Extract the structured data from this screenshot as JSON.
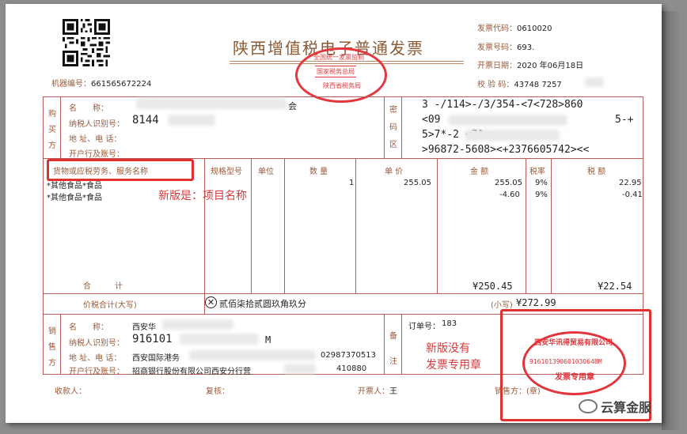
{
  "header": {
    "title": "陕西增值税电子普通发票",
    "machine_no_label": "机器编号：",
    "machine_no": "661565672224",
    "invoice_code_label": "发票代码：",
    "invoice_code": "0610020",
    "invoice_no_label": "发票号码：",
    "invoice_no": "693.",
    "issue_date_label": "开票日期：",
    "issue_date": "2020 年06月18日",
    "check_code_label": "校 验 码：",
    "check_code": "43748 7257"
  },
  "buyer": {
    "section_label": "购买方",
    "name_label": "名　　称：",
    "name_value": "会",
    "taxid_label": "纳税人识别号：",
    "taxid_value": "8144",
    "address_label": "地 址、电 话：",
    "bank_label": "开户行及账号："
  },
  "cipher": {
    "section_label": "密码区",
    "lines": [
      "3  -/114>-/3/354-<7<728>860",
      "<09",
      "5>7*-2                          <71<",
      ">96872-5608><+2376605742><<"
    ],
    "line2_tail": "5-+"
  },
  "items": {
    "headers": [
      "货物或应税劳务、服务名称",
      "规格型号",
      "单位",
      "数 量",
      "单 价",
      "金 额",
      "税率",
      "税 额"
    ],
    "rows": [
      {
        "name": "*其他食品*食品",
        "qty": "1",
        "price": "255.05",
        "amount": "255.05",
        "rate": "9%",
        "tax": "22.95"
      },
      {
        "name": "*其他食品*食品",
        "qty": "",
        "price": "",
        "amount": "-4.60",
        "rate": "9%",
        "tax": "-0.41"
      }
    ],
    "subtotal_label": "合　　　计",
    "subtotal_amount": "¥250.45",
    "subtotal_tax": "¥22.54",
    "annotation": "新版是：项目名称"
  },
  "total": {
    "label": "价税合计(大写)",
    "capital": "贰佰柒拾贰圆玖角玖分",
    "small_label": "(小写)",
    "small_value": "¥272.99"
  },
  "seller": {
    "section_label": "销售方",
    "name_label": "名　　称：",
    "name_value": "西安华",
    "taxid_label": "纳税人识别号：",
    "taxid_value": "916101",
    "taxid_tail": "M",
    "address_label": "地 址、电 话：",
    "address_value": "西安国际港务",
    "phone_value": "02987370513",
    "bank_label": "开户行及账号：",
    "bank_value": "招商银行股份有限公司西安分行营",
    "bank_tail": "410880"
  },
  "remarks": {
    "section_label": "备注",
    "order_label": "订单号：",
    "order_value": "183",
    "annotation_line1": "新版没有",
    "annotation_line2": "发票专用章"
  },
  "footer": {
    "payee_label": "收款人：",
    "reviewer_label": "复核：",
    "drawer_label": "开票人：",
    "drawer_value": "王",
    "seller_label": "销售方：(章)"
  },
  "seals": {
    "tax_seal_top": "全国统一发票监制",
    "tax_seal_mid": "国家税务总局",
    "tax_seal_bottom": "陕西省税务局",
    "company_seal_name": "西安华讯得贸易有限公司",
    "company_seal_id": "91610139060103064BM",
    "company_seal_label": "发票专用章"
  },
  "watermark": "云算金服",
  "colors": {
    "ink": "#b55a58",
    "annotation_red": "#e03030",
    "seal_red": "#e2343a"
  }
}
